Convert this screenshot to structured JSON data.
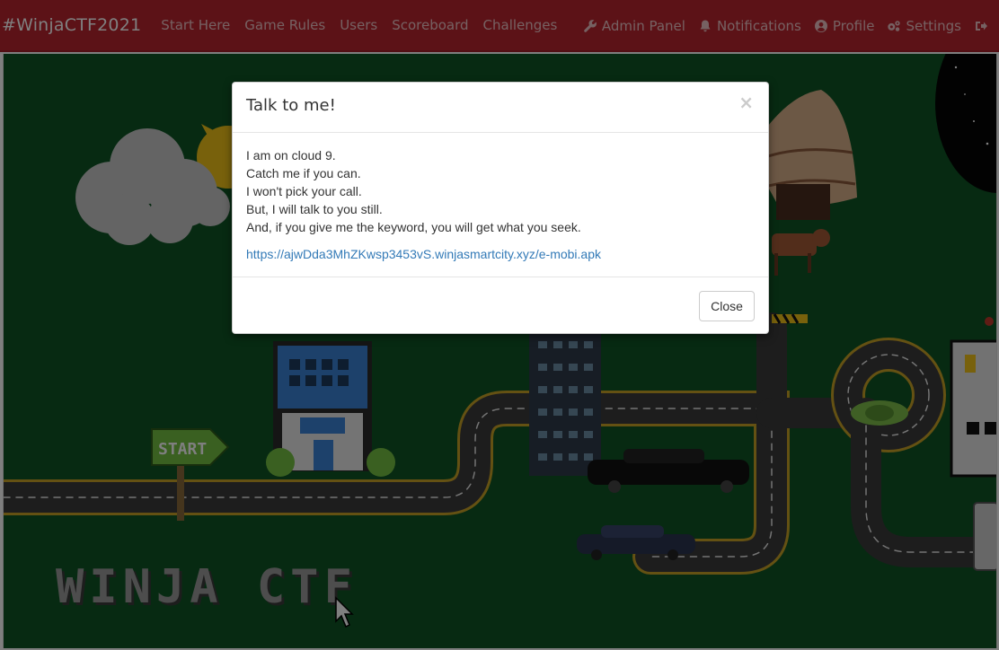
{
  "navbar": {
    "brand": "#WinjaCTF2021",
    "left_links": [
      {
        "label": "Start Here"
      },
      {
        "label": "Game Rules"
      },
      {
        "label": "Users"
      },
      {
        "label": "Scoreboard"
      },
      {
        "label": "Challenges"
      }
    ],
    "right_links": [
      {
        "label": "Admin Panel",
        "icon": "wrench-icon"
      },
      {
        "label": "Notifications",
        "icon": "bell-icon"
      },
      {
        "label": "Profile",
        "icon": "user-circle-icon"
      },
      {
        "label": "Settings",
        "icon": "cogs-icon"
      }
    ],
    "logout_icon": "sign-out-icon"
  },
  "game": {
    "start_sign": "START",
    "title": "WINJA CTF"
  },
  "modal": {
    "title": "Talk to me!",
    "close_symbol": "×",
    "lines": [
      "I am on cloud 9.",
      "Catch me if you can.",
      "I won't pick your call.",
      "But, I will talk to you still.",
      "And, if you give me the keyword, you will get what you seek."
    ],
    "link": "https://ajwDda3MhZKwsp3453vS.winjasmartcity.xyz/e-mobi.apk",
    "close_button": "Close"
  },
  "colors": {
    "navbar": "#b9252f",
    "game_background": "#0e5524",
    "link": "#337ab7"
  }
}
